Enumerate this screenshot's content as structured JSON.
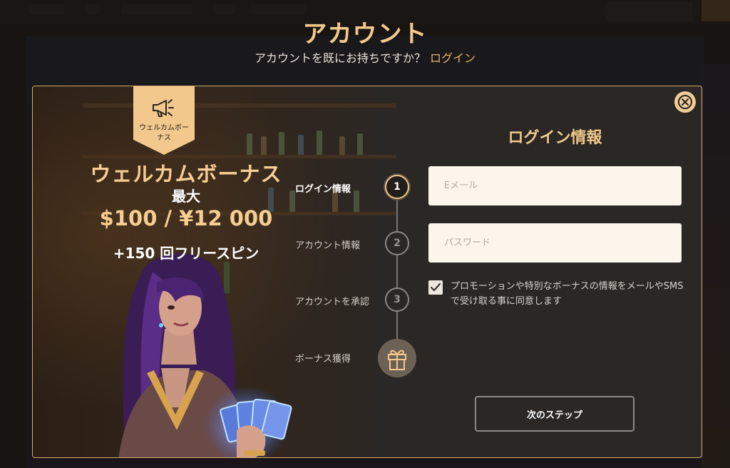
{
  "header": {
    "title": "アカウント",
    "subtitle": "アカウントを既にお持ちですか？",
    "login_link": "ログイン"
  },
  "promo": {
    "badge_text": "ウェルカムボーナス",
    "title": "ウェルカムボーナス",
    "upto": "最大",
    "amount": "$100 / ¥12 000",
    "spins": "+150 回フリースピン"
  },
  "stepper": {
    "steps": [
      {
        "number": "1",
        "label": "ログイン情報",
        "active": true
      },
      {
        "number": "2",
        "label": "アカウント情報",
        "active": false
      },
      {
        "number": "3",
        "label": "アカウントを承認",
        "active": false
      },
      {
        "number": "",
        "label": "ボーナス獲得",
        "icon": "gift-icon",
        "active": false
      }
    ]
  },
  "form": {
    "title": "ログイン情報",
    "email_placeholder": "Eメール",
    "password_placeholder": "パスワード",
    "consent_checked": true,
    "consent_text": "プロモーションや特別なボーナスの情報をメールやSMSで受け取る事に同意します",
    "next_button": "次のステップ"
  },
  "icons": {
    "close": "close-icon",
    "megaphone": "megaphone-icon",
    "gift": "gift-icon",
    "check": "check-icon"
  },
  "colors": {
    "accent": "#f2c88d",
    "link": "#e7b36b",
    "modal_bg": "#2a2725",
    "border": "#d9ab6b"
  }
}
